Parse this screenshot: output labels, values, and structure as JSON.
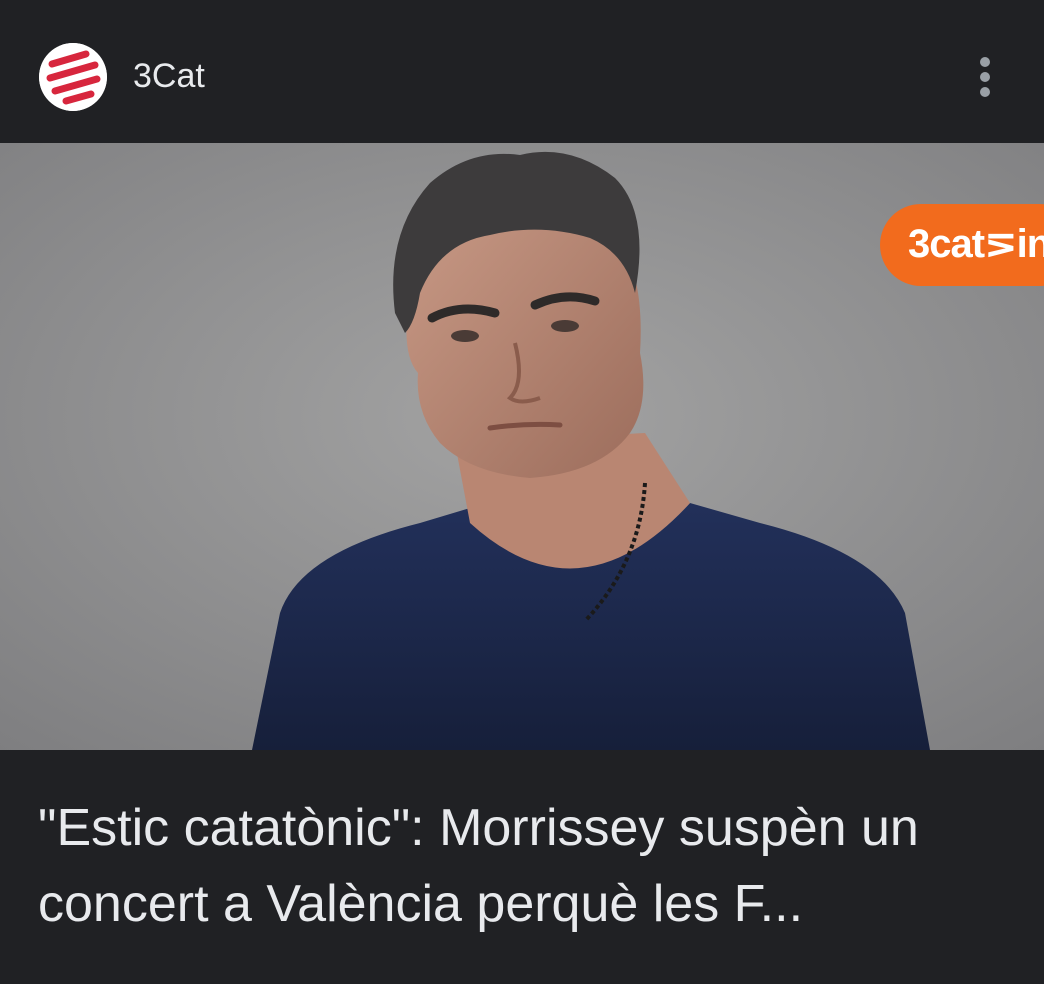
{
  "source": {
    "name": "3Cat",
    "logo_icon": "3cat-logo-icon",
    "logo_colors": [
      "#ffffff",
      "#d7263d"
    ]
  },
  "menu": {
    "icon": "more-vert-icon"
  },
  "image": {
    "badge_text": "3cat⋝in",
    "badge_color": "#f26b1d",
    "background_color": "#8f8f8f",
    "shirt_color": "#1c2a4a"
  },
  "article": {
    "title": "\"Estic catatònic\": Morrissey suspèn un concert a València perquè les F..."
  },
  "theme": {
    "background": "#202124",
    "text": "#e8eaed"
  }
}
